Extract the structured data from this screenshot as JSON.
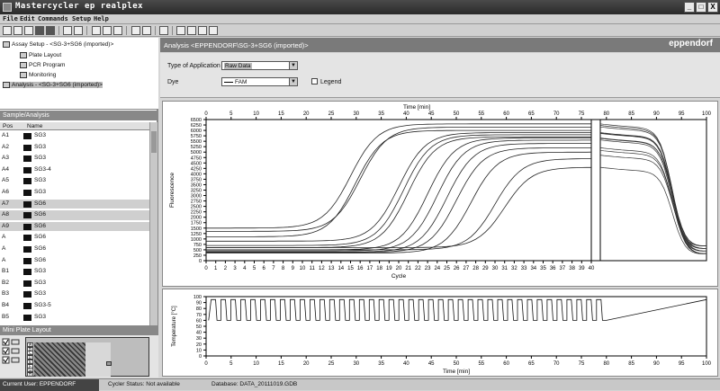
{
  "window": {
    "title": "Mastercycler ep realplex",
    "min": "_",
    "max": "□",
    "close": "X"
  },
  "menu": [
    "File",
    "Edit",
    "Commands",
    "Setup",
    "Help"
  ],
  "tree": {
    "root": "Assay Setup - <SG-3+SG6 (imported)>",
    "items": [
      "Plate Layout",
      "PCR Program",
      "Monitoring"
    ],
    "analysis": "Analysis - <SG-3+SG6 (imported)>"
  },
  "sample_panel": {
    "title": "Sample/Analysis",
    "col_pos": "Pos",
    "col_name": "Name",
    "rows": [
      {
        "pos": "A1",
        "name": "SG3"
      },
      {
        "pos": "A2",
        "name": "SG3"
      },
      {
        "pos": "A3",
        "name": "SG3"
      },
      {
        "pos": "A4",
        "name": "SG3-4"
      },
      {
        "pos": "A5",
        "name": "SG3"
      },
      {
        "pos": "A6",
        "name": "SG3"
      },
      {
        "pos": "A7",
        "name": "SG6"
      },
      {
        "pos": "A8",
        "name": "SG6"
      },
      {
        "pos": "A9",
        "name": "SG6"
      },
      {
        "pos": "A",
        "name": "SG6"
      },
      {
        "pos": "A",
        "name": "SG6"
      },
      {
        "pos": "A",
        "name": "SG6"
      },
      {
        "pos": "B1",
        "name": "SG3"
      },
      {
        "pos": "B2",
        "name": "SG3"
      },
      {
        "pos": "B3",
        "name": "SG3"
      },
      {
        "pos": "B4",
        "name": "SG3-5"
      },
      {
        "pos": "B5",
        "name": "SG3"
      }
    ]
  },
  "mini_plate": {
    "title": "Mini Plate Layout",
    "rows": [
      "A",
      "B",
      "C",
      "D",
      "E",
      "F",
      "G",
      "H"
    ]
  },
  "analysis": {
    "header": "Analysis <EPPENDORF\\SG-3+SG6 (imported)>",
    "brand": "eppendorf",
    "type_label": "Type of Application",
    "type_value": "Raw Data",
    "dye_label": "Dye",
    "dye_value": "FAM",
    "legend_label": "Legend"
  },
  "chart_data": [
    {
      "type": "line",
      "title": "",
      "xlabel": "Cycle",
      "x2label": "Time [min]",
      "ylabel": "Fluorescence",
      "xlim": [
        0,
        40
      ],
      "ylim": [
        0,
        6500
      ],
      "x_ticks": [
        0,
        1,
        2,
        3,
        4,
        5,
        6,
        7,
        8,
        9,
        10,
        11,
        12,
        13,
        14,
        15,
        16,
        17,
        18,
        19,
        20,
        21,
        22,
        23,
        24,
        25,
        26,
        27,
        28,
        29,
        30,
        31,
        32,
        33,
        34,
        35,
        36,
        37,
        38,
        39,
        40
      ],
      "y_ticks": [
        0,
        250,
        500,
        750,
        1000,
        1250,
        1500,
        1750,
        2000,
        2250,
        2500,
        2750,
        3000,
        3250,
        3500,
        3750,
        4000,
        4250,
        4500,
        4750,
        5000,
        5250,
        5500,
        5750,
        6000,
        6250,
        6500
      ],
      "time_ticks": [
        0,
        5,
        10,
        15,
        20,
        25,
        30,
        35,
        40,
        45,
        50,
        55,
        60,
        65,
        70,
        75,
        80,
        85,
        90,
        95,
        100
      ],
      "series": [
        {
          "base": 1500,
          "mid": 15,
          "top": 6300
        },
        {
          "base": 1350,
          "mid": 16,
          "top": 6150
        },
        {
          "base": 1100,
          "mid": 15.5,
          "top": 6000
        },
        {
          "base": 900,
          "mid": 20,
          "top": 5900
        },
        {
          "base": 700,
          "mid": 20.5,
          "top": 5800
        },
        {
          "base": 600,
          "mid": 21,
          "top": 5700
        },
        {
          "base": 500,
          "mid": 23,
          "top": 5650
        },
        {
          "base": 450,
          "mid": 24,
          "top": 5550
        },
        {
          "base": 400,
          "mid": 25,
          "top": 5400
        },
        {
          "base": 380,
          "mid": 26,
          "top": 5200
        },
        {
          "base": 350,
          "mid": 27.5,
          "top": 5000
        },
        {
          "base": 500,
          "mid": 30,
          "top": 4700
        },
        {
          "base": 600,
          "mid": 31,
          "top": 4300
        }
      ]
    },
    {
      "type": "line",
      "title": "",
      "xlabel": "Time [min]",
      "ylabel": "Temperature [°C]",
      "xlim": [
        0,
        100
      ],
      "ylim": [
        0,
        100
      ],
      "x_ticks": [
        0,
        5,
        10,
        15,
        20,
        25,
        30,
        35,
        40,
        45,
        50,
        55,
        60,
        65,
        70,
        75,
        80,
        85,
        90,
        95,
        100
      ],
      "y_ticks": [
        0,
        10,
        20,
        30,
        40,
        50,
        60,
        70,
        80,
        90,
        100
      ],
      "cycles": 40,
      "high": 95,
      "low": 60,
      "melt_start": [
        80,
        60
      ],
      "melt_end": [
        100,
        95
      ]
    }
  ],
  "status": {
    "user": "Current User: EPPENDORF",
    "cycler": "Cycler Status: Not available",
    "database": "Database: DATA_20111019.GDB"
  }
}
